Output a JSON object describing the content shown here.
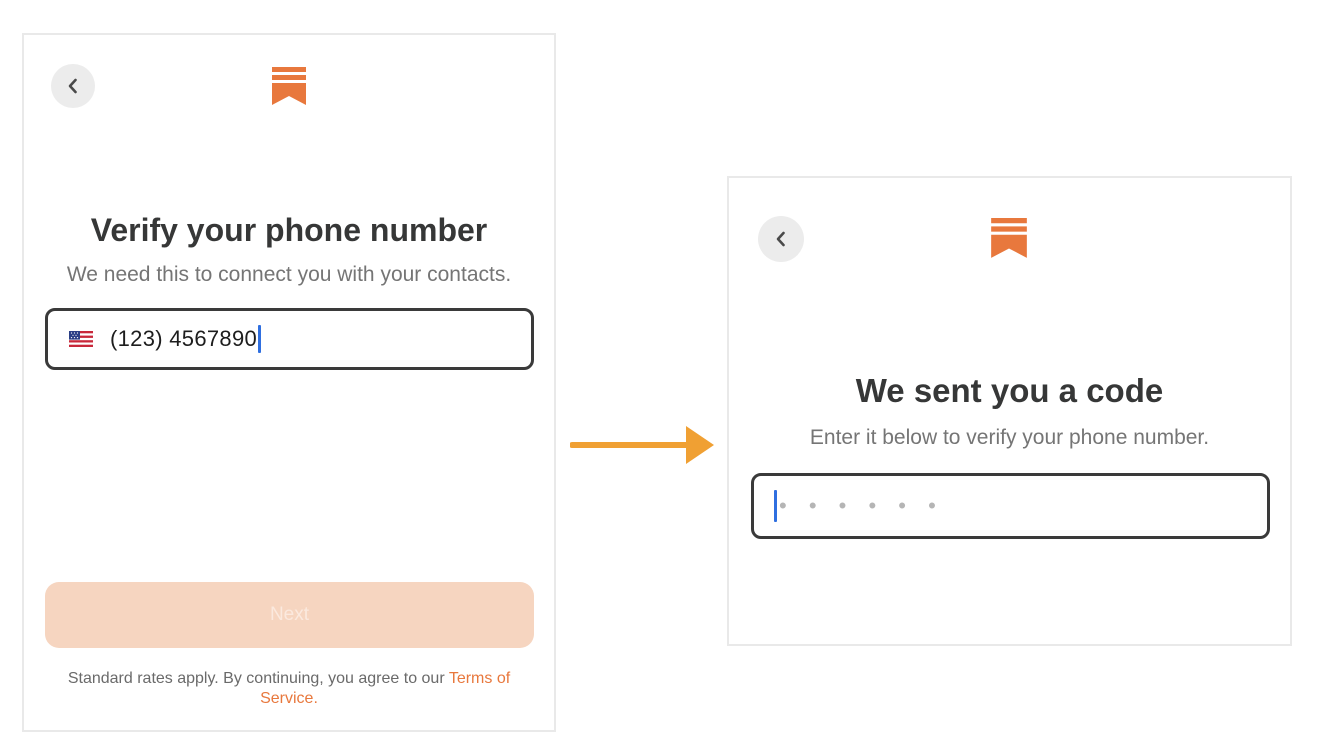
{
  "screens": {
    "left": {
      "title": "Verify your phone number",
      "subtitle": "We need this to connect you with your contacts.",
      "phone": {
        "country_flag": "us-flag-icon",
        "value": "(123) 4567890"
      },
      "next_button": "Next",
      "legal": {
        "text": "Standard rates apply. By continuing, you agree to our ",
        "link": "Terms of Service",
        "suffix": "."
      }
    },
    "right": {
      "title": "We sent you a code",
      "subtitle": "Enter it below to verify your phone number.",
      "code": {
        "placeholder": "• • • • • •"
      }
    }
  },
  "icons": {
    "back": "chevron-left-icon",
    "logo": "substack-logo-icon",
    "flow": "arrow-right-icon"
  },
  "colors": {
    "brand": "#e8783d",
    "button_disabled": "#f6d5c0",
    "arrow": "#f0a033",
    "caret": "#2f6fe0"
  }
}
